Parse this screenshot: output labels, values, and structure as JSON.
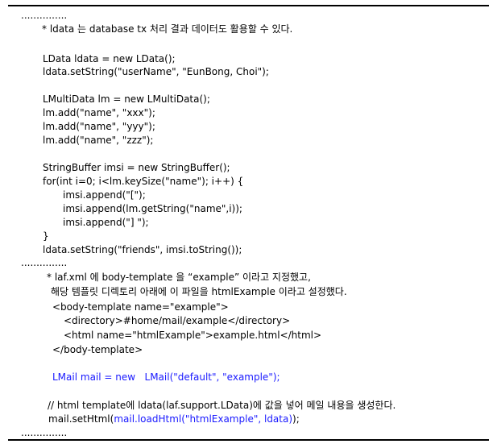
{
  "doc": {
    "dots_top": "...............",
    "note1": "* ldata 는 database tx 처리 결과 데이터도 활용할 수 있다.",
    "code1": [
      "LData ldata = new LData();",
      "ldata.setString(\"userName\", \"EunBong, Choi\");",
      "LMultiData lm = new LMultiData();",
      "lm.add(\"name\", \"xxx\");",
      "lm.add(\"name\", \"yyy\");",
      "lm.add(\"name\", \"zzz\");",
      "StringBuffer imsi = new StringBuffer();",
      "for(int i=0; i<lm.keySize(\"name\"); i++) {",
      "imsi.append(\"[\");",
      "imsi.append(lm.getString(\"name\",i));",
      "imsi.append(\"] \");",
      "}",
      "ldata.setString(\"friends\", imsi.toString());"
    ],
    "dots_mid": "...............",
    "note2a": "* laf.xml 에 body-template 을 “example” 이라고 지정했고,",
    "note2b": "해당 템플릿 디렉토리 아래에 이 파일을 htmlExample 이라고 설정했다.",
    "xml": [
      "<body-template name=\"example\">",
      "<directory>#home/mail/example</directory>",
      "<html name=\"htmlExample\">example.html</html>",
      "</body-template>"
    ],
    "mail_create": "LMail mail = new   LMail(\"default\", \"example\");",
    "comment": "// html template에 ldata(laf.support.LData)에 값을 넣어 메일 내용을 생성한다.",
    "sethtml_prefix": "mail.setHtml(",
    "sethtml_call": "mail.loadHtml(\"htmlExample\", ldata)",
    "sethtml_suffix": ");",
    "dots_bottom": "..............."
  }
}
